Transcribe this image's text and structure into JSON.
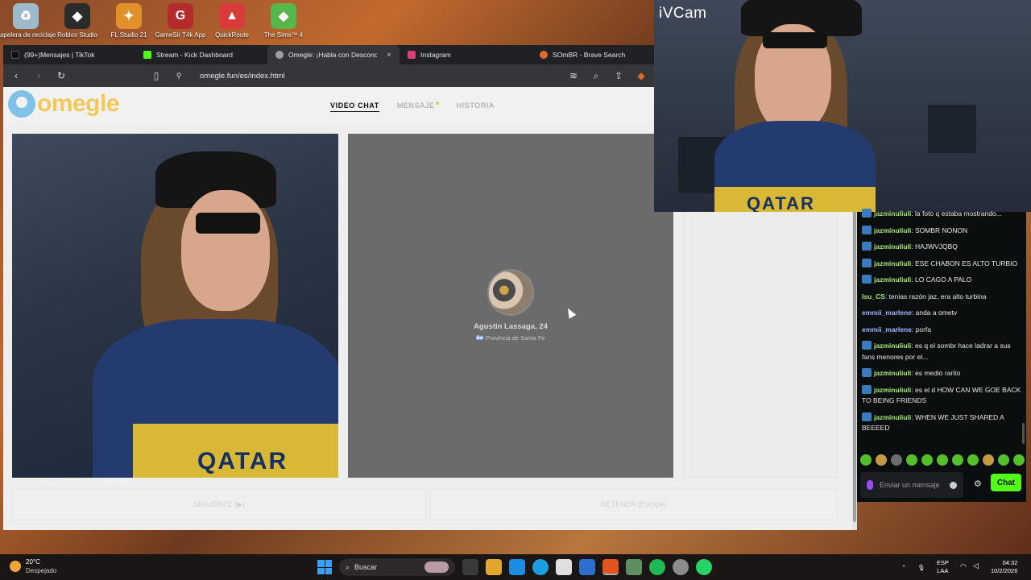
{
  "desktop": {
    "icons": [
      {
        "label": "Papelera de reciclaje",
        "color": "#9fb9cc",
        "glyph": "♻"
      },
      {
        "label": "Roblox Studio",
        "color": "#2b2b2b",
        "glyph": "◆"
      },
      {
        "label": "FL Studio 21",
        "color": "#e2902a",
        "glyph": "✦"
      },
      {
        "label": "GameSir T4k App",
        "color": "#b32b2b",
        "glyph": "G"
      },
      {
        "label": "QuickRoute",
        "color": "#d93b3b",
        "glyph": "▲"
      },
      {
        "label": "The Sims™ 4",
        "color": "#58b54a",
        "glyph": "◆"
      }
    ]
  },
  "browser": {
    "tabs": [
      {
        "label": "(99+)Mensajes | TikTok",
        "color": "#111111"
      },
      {
        "label": "Stream - Kick Dashboard",
        "color": "#53fc18"
      },
      {
        "label": "Omegle: ¡Habla con Descono...",
        "color": "#9aa0a6",
        "active": true
      },
      {
        "label": "Instagram",
        "color": "#d9407a"
      },
      {
        "label": "SOmBR - Brave Search",
        "color": "#e06a2c"
      }
    ],
    "close_glyph": "×",
    "url": "omegle.fun/es/index.html"
  },
  "site": {
    "logo": "omegle",
    "nav": {
      "video_chat": "VIDEO CHAT",
      "message": "MENSAJE",
      "history": "HISTORIA"
    }
  },
  "left_video": {
    "shirt_text": "QATAR"
  },
  "stranger": {
    "name": "Agustin Lassaga, 24",
    "location": "🇦🇷 Provincia de Santa Fe"
  },
  "buttons": {
    "next": "SIGUIENTE (▶)",
    "stop": "DETENER (Escape)"
  },
  "webcam": {
    "title": "iVCam",
    "shirt_text": "QATAR"
  },
  "chat": {
    "messages": [
      {
        "user": "jazminuliuli",
        "text": ": la foto q estaba mostrando...",
        "badge": true,
        "cls": "green"
      },
      {
        "user": "jazminuliuli",
        "text": ": SOMBR NONON",
        "badge": true,
        "cls": "green"
      },
      {
        "user": "jazminuliuli",
        "text": ": HAJWVJQBQ",
        "badge": true,
        "cls": "green"
      },
      {
        "user": "jazminuliuli",
        "text": ": ESE CHABON ES ALTO TURBIO",
        "badge": true,
        "cls": "green"
      },
      {
        "user": "jazminuliuli",
        "text": ": LO CAGO A PALO",
        "badge": true,
        "cls": "green"
      },
      {
        "user": "Isu_CS",
        "text": ": tenias razón jaz, era alto turbina",
        "badge": false,
        "cls": "green"
      },
      {
        "user": "emmii_marlene",
        "text": ": anda a ometv",
        "badge": false,
        "cls": "purple"
      },
      {
        "user": "emmii_marlene",
        "text": ": porfa",
        "badge": false,
        "cls": "purple"
      },
      {
        "user": "jazminuliuli",
        "text": ": es q el sombr hace ladrar a sus fans menores por el...",
        "badge": true,
        "cls": "green"
      },
      {
        "user": "jazminuliuli",
        "text": ": es medio rarito",
        "badge": true,
        "cls": "green"
      },
      {
        "user": "jazminuliuli",
        "text": ": es el d HOW CAN WE GOE BACK TO BEING FRIENDS",
        "badge": true,
        "cls": "green"
      },
      {
        "user": "jazminuliuli",
        "text": ": WHEN WE JUST SHARED A BEEEED",
        "badge": true,
        "cls": "green"
      }
    ],
    "input_placeholder": "Enviar un mensaje",
    "send_label": "Chat",
    "settings_glyph": "⚙",
    "accent": "#53fc18"
  },
  "taskbar": {
    "temperature": "20°C",
    "weather": "Despejado",
    "search_label": "Buscar",
    "lang_top": "ESP",
    "lang_bottom": "LAA",
    "time": "04:32",
    "date": "10/2/2026",
    "apps": [
      "#3a3a3a",
      "#e2a72b",
      "#1c8ce0",
      "#e0e0e0",
      "#2d6fcf",
      "#e2531e",
      "#5d8f60",
      "#1db954",
      "#8c8c8c",
      "#25d366"
    ]
  }
}
